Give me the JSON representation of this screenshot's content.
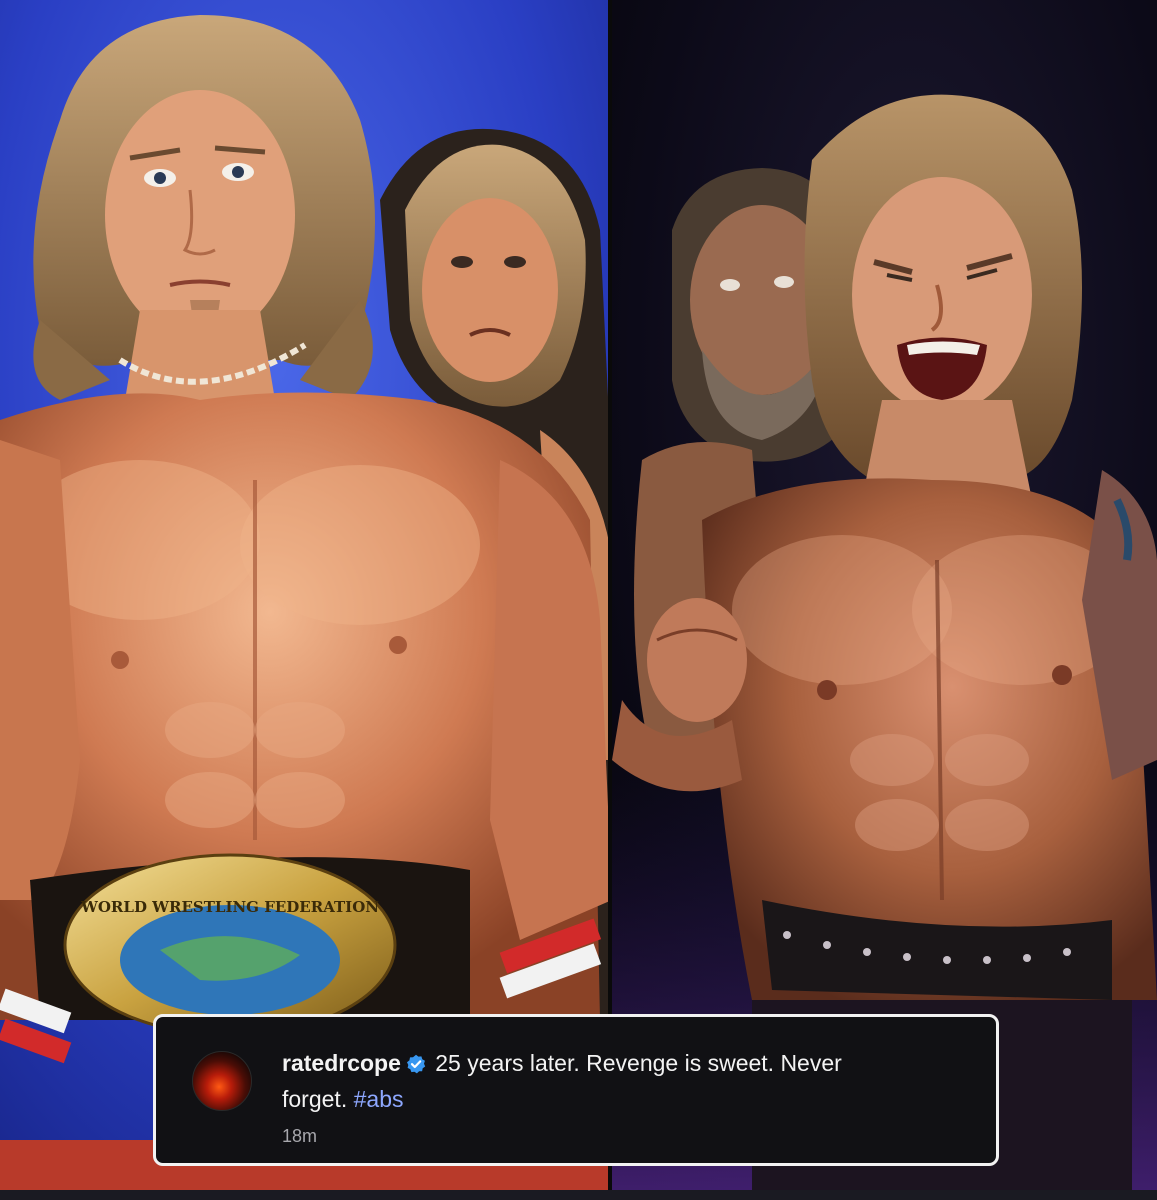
{
  "comment": {
    "username": "ratedrcope",
    "text_line1": "25 years later. Revenge is sweet. Never",
    "text_line2": "forget.",
    "hashtag": "#abs",
    "timestamp": "18m"
  },
  "belt_text": "WORLD WRESTLING FEDERATION",
  "colors": {
    "card_background": "#111114",
    "card_border": "#f2f2f2",
    "text": "#f3f3f3",
    "hashtag": "#8ea8ff",
    "timestamp": "#a8a8ad",
    "verified_badge": "#3897f0"
  }
}
